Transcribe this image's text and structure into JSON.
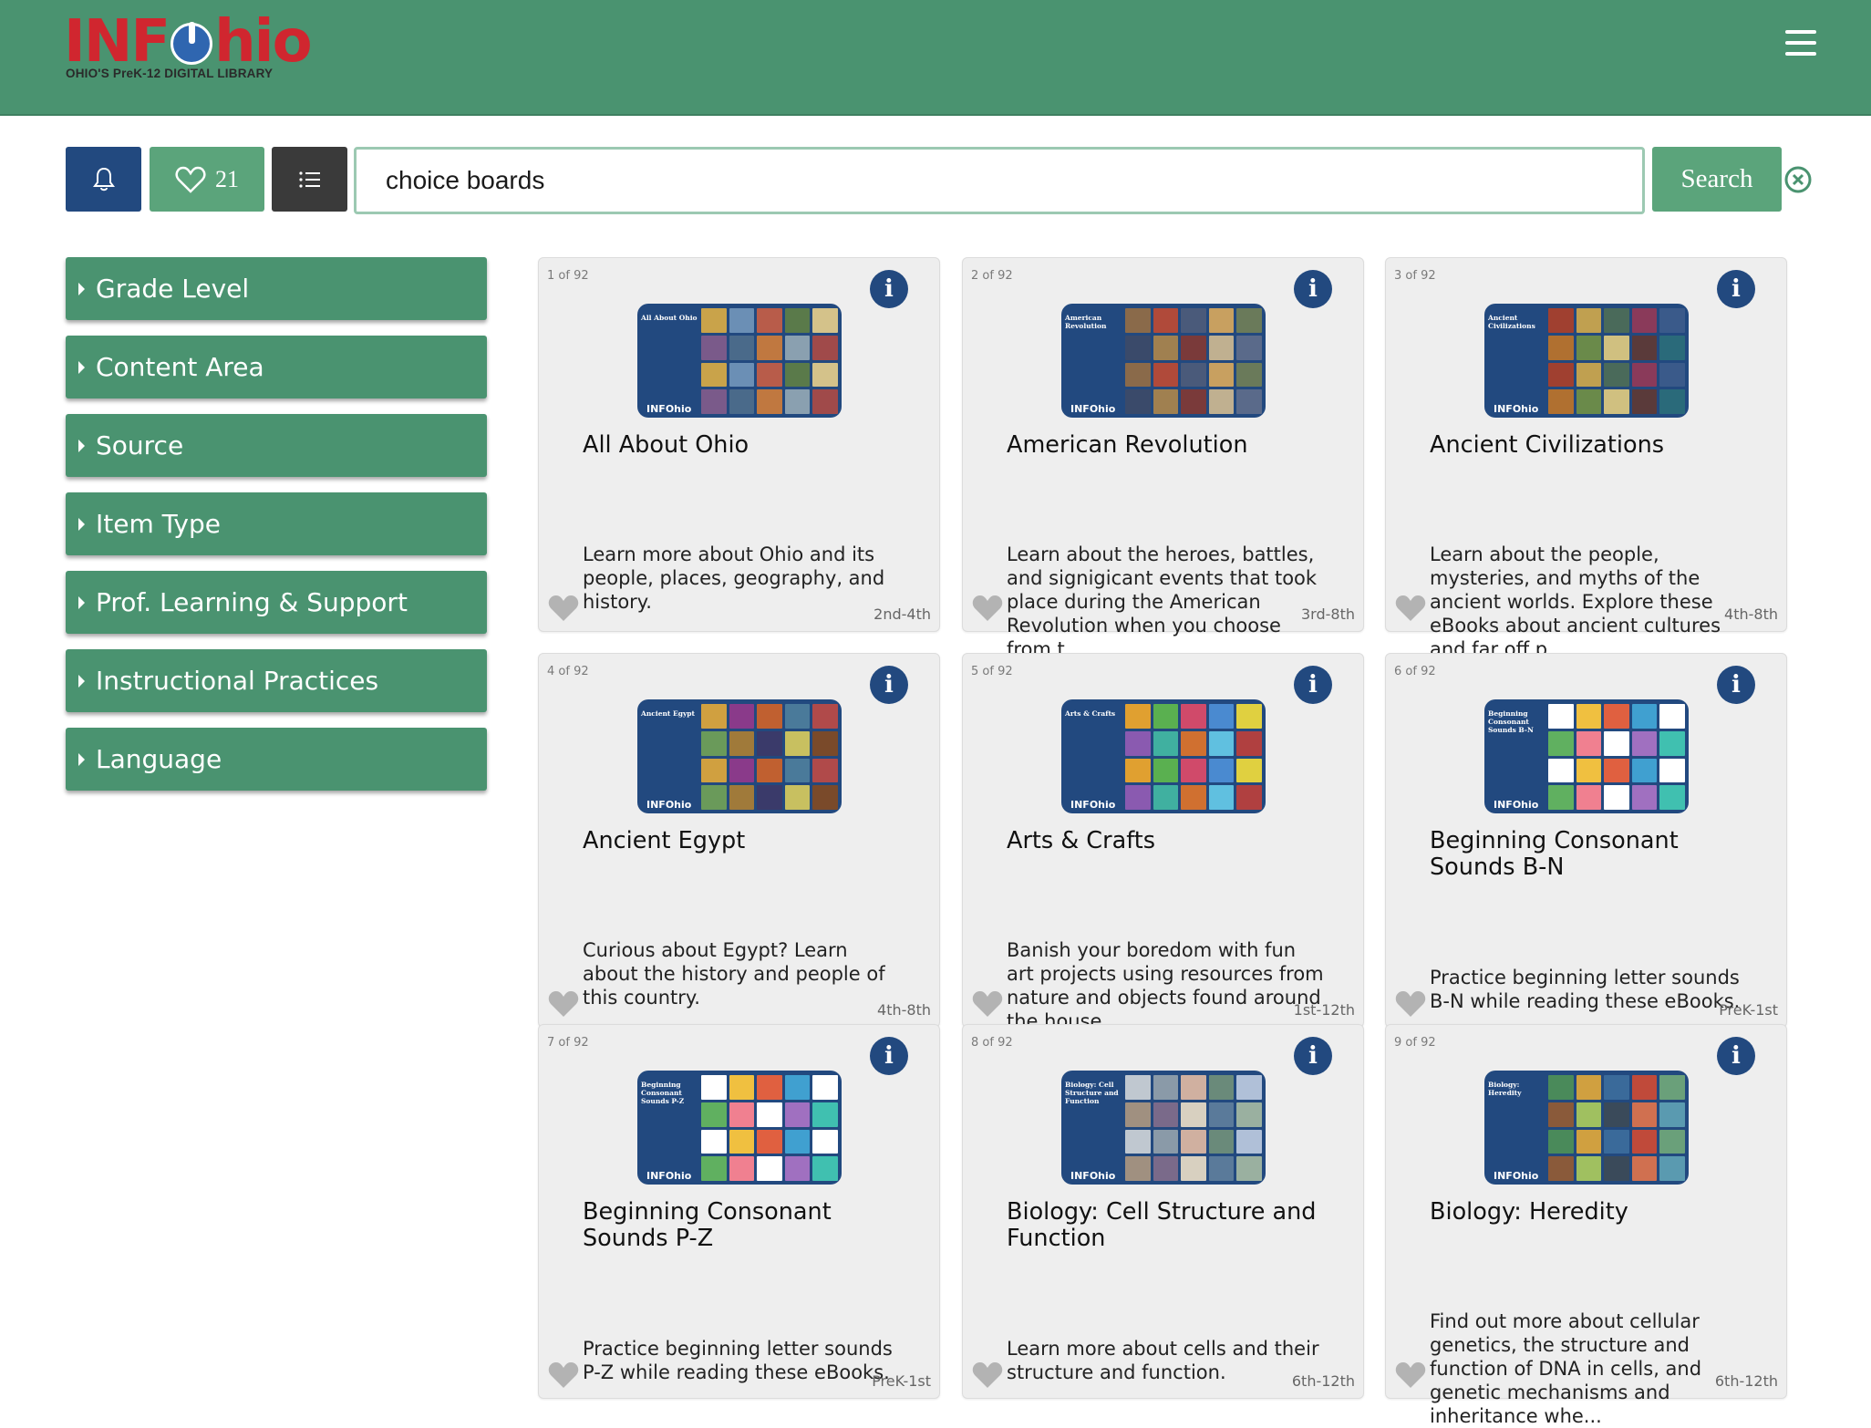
{
  "header": {
    "logo_text": "INFOhio",
    "logo_subtitle": "OHIO'S PreK-12 DIGITAL LIBRARY"
  },
  "toolbar": {
    "favorites_count": "21",
    "search_value": "choice boards",
    "search_label": "Search"
  },
  "facets": [
    {
      "label": "Grade Level"
    },
    {
      "label": "Content Area"
    },
    {
      "label": "Source"
    },
    {
      "label": "Item Type"
    },
    {
      "label": "Prof. Learning & Support"
    },
    {
      "label": "Instructional Practices"
    },
    {
      "label": "Language"
    }
  ],
  "results": [
    {
      "count": "1 of 92",
      "title": "All About Ohio",
      "description": "Learn more about Ohio and its people, places, geography, and history.",
      "grade": "2nd-4th",
      "thumb_label": "All About Ohio",
      "thumb_brand": "INFOhio"
    },
    {
      "count": "2 of 92",
      "title": "American Revolution",
      "description": "Learn about the heroes, battles, and signigicant events that took place during the American Revolution when you choose from t...",
      "grade": "3rd-8th",
      "thumb_label": "American Revolution",
      "thumb_brand": "INFOhio"
    },
    {
      "count": "3 of 92",
      "title": "Ancient Civilizations",
      "description": "Learn about the people, mysteries, and myths of the ancient worlds. Explore these eBooks about ancient cultures and far off p...",
      "grade": "4th-8th",
      "thumb_label": "Ancient Civilizations",
      "thumb_brand": "INFOhio"
    },
    {
      "count": "4 of 92",
      "title": "Ancient Egypt",
      "description": "Curious about Egypt? Learn about the history and people of this country.",
      "grade": "4th-8th",
      "thumb_label": "Ancient Egypt",
      "thumb_brand": "INFOhio"
    },
    {
      "count": "5 of 92",
      "title": "Arts & Crafts",
      "description": "Banish your boredom with fun art projects using resources from nature and objects found around the house.",
      "grade": "1st-12th",
      "thumb_label": "Arts & Crafts",
      "thumb_brand": "INFOhio"
    },
    {
      "count": "6 of 92",
      "title": "Beginning Consonant Sounds B-N",
      "description": "Practice beginning letter sounds B-N while reading these eBooks.",
      "grade": "PreK-1st",
      "thumb_label": "Beginning Consonant Sounds B-N",
      "thumb_brand": "INFOhio"
    },
    {
      "count": "7 of 92",
      "title": "Beginning Consonant Sounds P-Z",
      "description": "Practice beginning letter sounds P-Z while reading these eBooks.",
      "grade": "PreK-1st",
      "thumb_label": "Beginning Consonant Sounds P-Z",
      "thumb_brand": "INFOhio"
    },
    {
      "count": "8 of 92",
      "title": "Biology: Cell Structure and Function",
      "description": "Learn more about cells and their structure and function.",
      "grade": "6th-12th",
      "thumb_label": "Biology: Cell Structure and Function",
      "thumb_brand": "INFOhio"
    },
    {
      "count": "9 of 92",
      "title": "Biology: Heredity",
      "description": "Find out more about cellular genetics, the structure and function of DNA in cells, and genetic mechanisms and inheritance whe...",
      "grade": "6th-12th",
      "thumb_label": "Biology: Heredity",
      "thumb_brand": "INFOhio"
    }
  ],
  "colors": {
    "header_green": "#4a9370",
    "button_green": "#5ba47b",
    "navy": "#22497f",
    "logo_red": "#d0262f"
  },
  "icons": {
    "notifications": "bell-icon",
    "favorites": "heart-icon",
    "list": "list-icon",
    "clear": "clear-circle-x-icon",
    "menu": "hamburger-menu-icon",
    "info": "info-icon",
    "favorite_toggle": "heart-icon"
  }
}
